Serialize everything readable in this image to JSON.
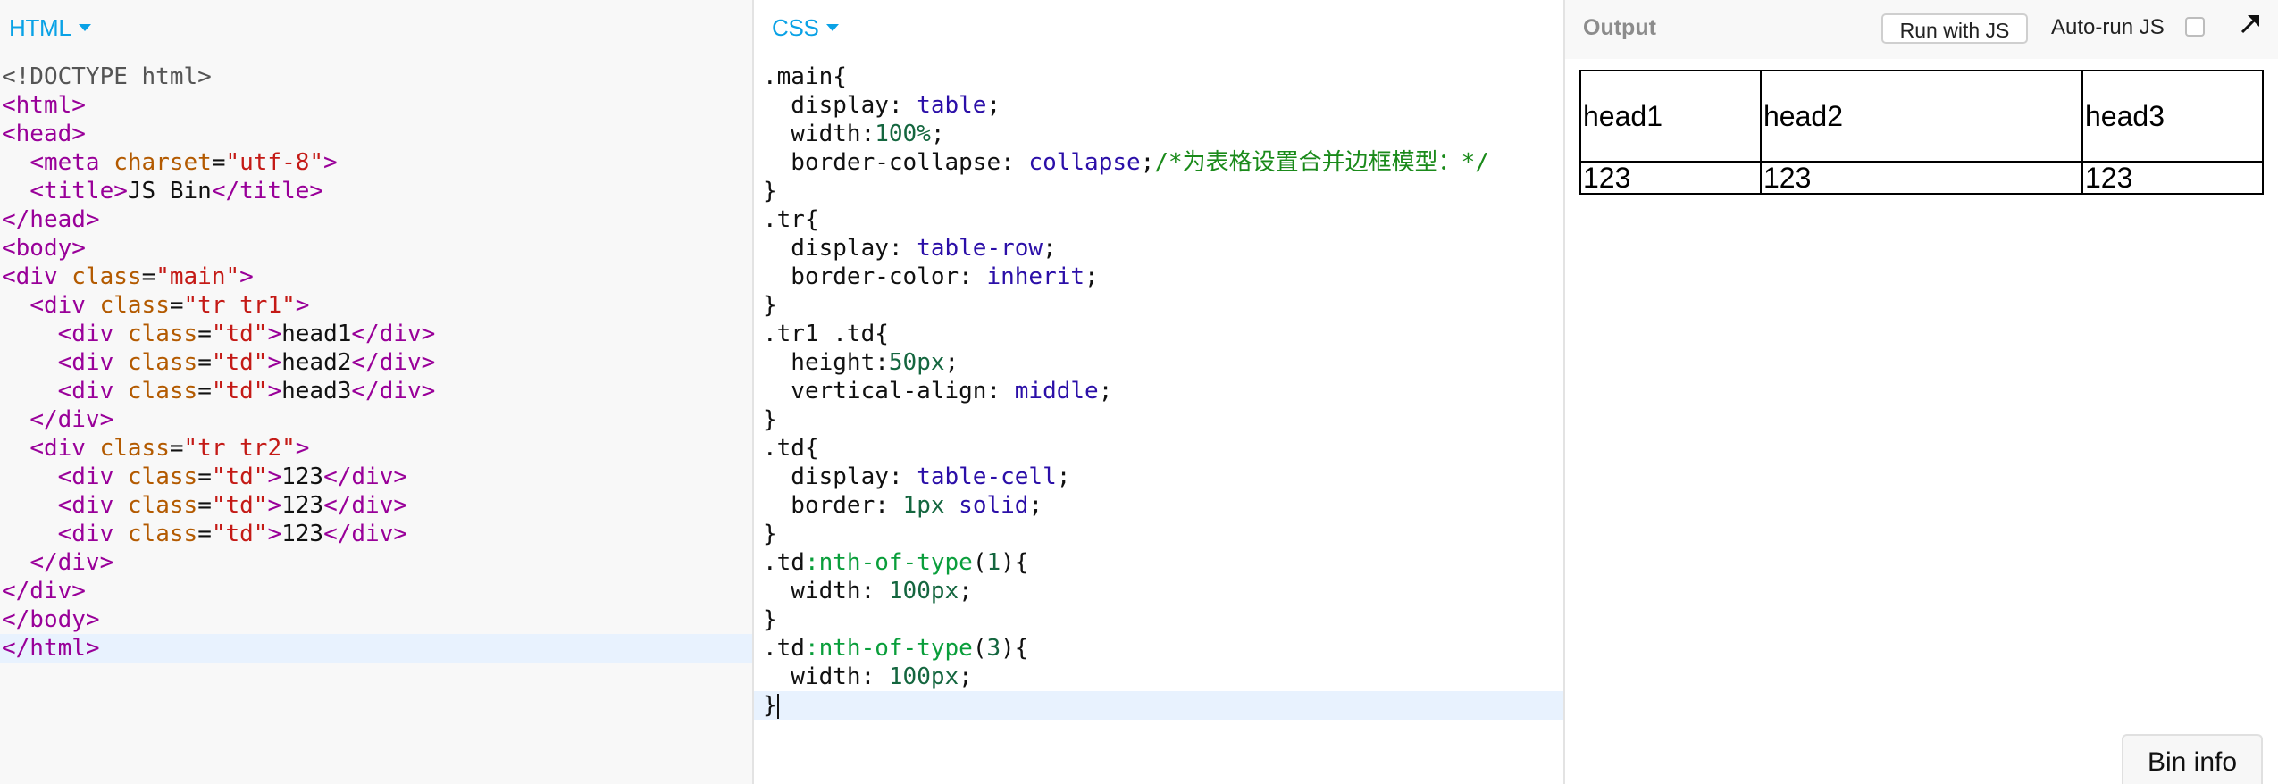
{
  "html_panel": {
    "label": "HTML",
    "lines": [
      [
        [
          "doc",
          "<!DOCTYPE html>"
        ]
      ],
      [
        [
          "tag",
          "<html>"
        ]
      ],
      [
        [
          "tag",
          "<head>"
        ]
      ],
      [
        [
          "txt",
          "  "
        ],
        [
          "tag",
          "<meta "
        ],
        [
          "attr",
          "charset"
        ],
        [
          "txt",
          "="
        ],
        [
          "str",
          "\"utf-8\""
        ],
        [
          "tag",
          ">"
        ]
      ],
      [
        [
          "txt",
          "  "
        ],
        [
          "tag",
          "<title>"
        ],
        [
          "txt",
          "JS Bin"
        ],
        [
          "tag",
          "</title>"
        ]
      ],
      [
        [
          "tag",
          "</head>"
        ]
      ],
      [
        [
          "tag",
          "<body>"
        ]
      ],
      [
        [
          "tag",
          "<div "
        ],
        [
          "attr",
          "class"
        ],
        [
          "txt",
          "="
        ],
        [
          "str",
          "\"main\""
        ],
        [
          "tag",
          ">"
        ]
      ],
      [
        [
          "txt",
          "  "
        ],
        [
          "tag",
          "<div "
        ],
        [
          "attr",
          "class"
        ],
        [
          "txt",
          "="
        ],
        [
          "str",
          "\"tr tr1\""
        ],
        [
          "tag",
          ">"
        ]
      ],
      [
        [
          "txt",
          "    "
        ],
        [
          "tag",
          "<div "
        ],
        [
          "attr",
          "class"
        ],
        [
          "txt",
          "="
        ],
        [
          "str",
          "\"td\""
        ],
        [
          "tag",
          ">"
        ],
        [
          "txt",
          "head1"
        ],
        [
          "tag",
          "</div>"
        ]
      ],
      [
        [
          "txt",
          "    "
        ],
        [
          "tag",
          "<div "
        ],
        [
          "attr",
          "class"
        ],
        [
          "txt",
          "="
        ],
        [
          "str",
          "\"td\""
        ],
        [
          "tag",
          ">"
        ],
        [
          "txt",
          "head2"
        ],
        [
          "tag",
          "</div>"
        ]
      ],
      [
        [
          "txt",
          "    "
        ],
        [
          "tag",
          "<div "
        ],
        [
          "attr",
          "class"
        ],
        [
          "txt",
          "="
        ],
        [
          "str",
          "\"td\""
        ],
        [
          "tag",
          ">"
        ],
        [
          "txt",
          "head3"
        ],
        [
          "tag",
          "</div>"
        ]
      ],
      [
        [
          "txt",
          "  "
        ],
        [
          "tag",
          "</div>"
        ]
      ],
      [
        [
          "txt",
          "  "
        ],
        [
          "tag",
          "<div "
        ],
        [
          "attr",
          "class"
        ],
        [
          "txt",
          "="
        ],
        [
          "str",
          "\"tr tr2\""
        ],
        [
          "tag",
          ">"
        ]
      ],
      [
        [
          "txt",
          "    "
        ],
        [
          "tag",
          "<div "
        ],
        [
          "attr",
          "class"
        ],
        [
          "txt",
          "="
        ],
        [
          "str",
          "\"td\""
        ],
        [
          "tag",
          ">"
        ],
        [
          "txt",
          "123"
        ],
        [
          "tag",
          "</div>"
        ]
      ],
      [
        [
          "txt",
          "    "
        ],
        [
          "tag",
          "<div "
        ],
        [
          "attr",
          "class"
        ],
        [
          "txt",
          "="
        ],
        [
          "str",
          "\"td\""
        ],
        [
          "tag",
          ">"
        ],
        [
          "txt",
          "123"
        ],
        [
          "tag",
          "</div>"
        ]
      ],
      [
        [
          "txt",
          "    "
        ],
        [
          "tag",
          "<div "
        ],
        [
          "attr",
          "class"
        ],
        [
          "txt",
          "="
        ],
        [
          "str",
          "\"td\""
        ],
        [
          "tag",
          ">"
        ],
        [
          "txt",
          "123"
        ],
        [
          "tag",
          "</div>"
        ]
      ],
      [
        [
          "txt",
          "  "
        ],
        [
          "tag",
          "</div>"
        ]
      ],
      [
        [
          "tag",
          "</div>"
        ]
      ],
      [
        [
          "tag",
          "</body>"
        ]
      ],
      [
        [
          "tag",
          "</html>"
        ]
      ]
    ],
    "active_line": 20
  },
  "css_panel": {
    "label": "CSS",
    "lines": [
      [
        [
          "prop",
          ".main{"
        ]
      ],
      [
        [
          "prop",
          "  display: "
        ],
        [
          "kw",
          "table"
        ],
        [
          "prop",
          ";"
        ]
      ],
      [
        [
          "prop",
          "  width:"
        ],
        [
          "num",
          "100%"
        ],
        [
          "prop",
          ";"
        ]
      ],
      [
        [
          "prop",
          "  border-collapse: "
        ],
        [
          "kw",
          "collapse"
        ],
        [
          "prop",
          ";"
        ],
        [
          "cmt",
          "/*为表格设置合并边框模型：*/"
        ]
      ],
      [
        [
          "prop",
          "}"
        ]
      ],
      [
        [
          "prop",
          ".tr{"
        ]
      ],
      [
        [
          "prop",
          "  display: "
        ],
        [
          "kw",
          "table-row"
        ],
        [
          "prop",
          ";"
        ]
      ],
      [
        [
          "prop",
          "  border-color: "
        ],
        [
          "kw",
          "inherit"
        ],
        [
          "prop",
          ";"
        ]
      ],
      [
        [
          "prop",
          "}"
        ]
      ],
      [
        [
          "prop",
          ".tr1 .td{"
        ]
      ],
      [
        [
          "prop",
          "  height:"
        ],
        [
          "num",
          "50px"
        ],
        [
          "prop",
          ";"
        ]
      ],
      [
        [
          "prop",
          "  vertical-align: "
        ],
        [
          "kw",
          "middle"
        ],
        [
          "prop",
          ";"
        ]
      ],
      [
        [
          "prop",
          "}"
        ]
      ],
      [
        [
          "prop",
          ".td{"
        ]
      ],
      [
        [
          "prop",
          "  display: "
        ],
        [
          "kw",
          "table-cell"
        ],
        [
          "prop",
          ";"
        ]
      ],
      [
        [
          "prop",
          "  border: "
        ],
        [
          "num",
          "1px"
        ],
        [
          "prop",
          " "
        ],
        [
          "kw",
          "solid"
        ],
        [
          "prop",
          ";"
        ]
      ],
      [
        [
          "prop",
          "}"
        ]
      ],
      [
        [
          "prop",
          ".td"
        ],
        [
          "pseudo",
          ":nth-of-type"
        ],
        [
          "prop",
          "("
        ],
        [
          "num",
          "1"
        ],
        [
          "prop",
          "){"
        ]
      ],
      [
        [
          "prop",
          "  width: "
        ],
        [
          "num",
          "100px"
        ],
        [
          "prop",
          ";"
        ]
      ],
      [
        [
          "prop",
          "}"
        ]
      ],
      [
        [
          "prop",
          ".td"
        ],
        [
          "pseudo",
          ":nth-of-type"
        ],
        [
          "prop",
          "("
        ],
        [
          "num",
          "3"
        ],
        [
          "prop",
          "){"
        ]
      ],
      [
        [
          "prop",
          "  width: "
        ],
        [
          "num",
          "100px"
        ],
        [
          "prop",
          ";"
        ]
      ],
      [
        [
          "prop",
          "}"
        ]
      ]
    ],
    "active_line": 22
  },
  "output_panel": {
    "label": "Output",
    "run_button": "Run with JS",
    "autorun_label": "Auto-run JS",
    "autorun_checked": false,
    "popout_icon": "popout-arrow-icon",
    "table": {
      "row1": [
        "head1",
        "head2",
        "head3"
      ],
      "row2": [
        "123",
        "123",
        "123"
      ]
    },
    "bin_info": "Bin info"
  },
  "colors": {
    "accent": "#0aa2e6",
    "active_line": "#e8f2fe",
    "tag": "#990099",
    "attr": "#b35a00",
    "string": "#c41a16",
    "keyword": "#2b0fa8",
    "number": "#14663f",
    "pseudo": "#0a9e3b",
    "comment": "#1a8a1a"
  }
}
